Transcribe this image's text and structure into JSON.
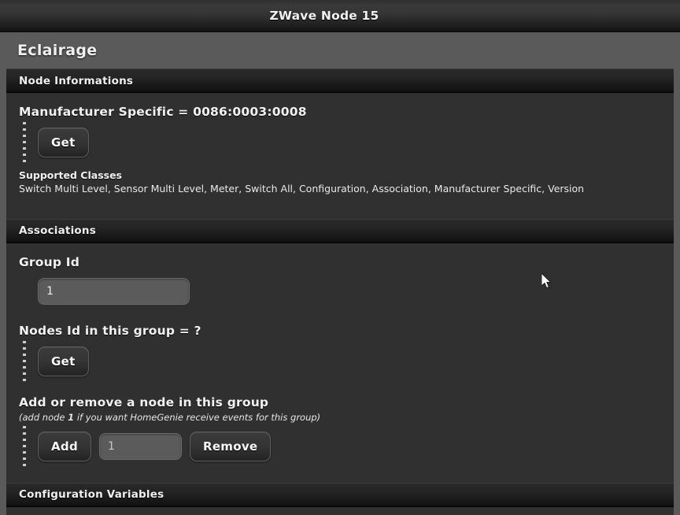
{
  "window": {
    "title": "ZWave Node 15"
  },
  "page": {
    "title": "Eclairage"
  },
  "sections": {
    "node_informations": {
      "header": "Node Informations",
      "manufacturer_specific_label": "Manufacturer Specific = 0086:0003:0008",
      "get_button": "Get",
      "supported_classes_label": "Supported Classes",
      "supported_classes_value": "Switch Multi Level, Sensor Multi Level, Meter, Switch All, Configuration, Association, Manufacturer Specific, Version"
    },
    "associations": {
      "header": "Associations",
      "group_id_label": "Group Id",
      "group_id_value": "1",
      "group_id_placeholder": "1",
      "nodes_in_group_label": "Nodes Id in this group = ?",
      "nodes_get_button": "Get",
      "add_remove_label": "Add or remove a node in this group",
      "add_remove_hint_pre": "(add node ",
      "add_remove_hint_bold": "1",
      "add_remove_hint_post": " if you want HomeGenie receive events for this group)",
      "add_button": "Add",
      "node_id_value": "1",
      "node_id_placeholder": "1",
      "remove_button": "Remove"
    },
    "configuration_variables": {
      "header": "Configuration Variables"
    }
  },
  "colors": {
    "page_background": "#5a5a5a",
    "panel_background": "#303030",
    "titlebar_dark": "#1b1b1b",
    "text_primary": "#f2f2f2",
    "input_background": "#5b5b5b"
  }
}
